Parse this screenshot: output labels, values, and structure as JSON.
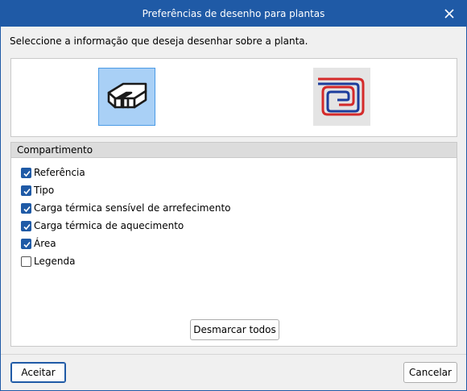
{
  "window": {
    "title": "Preferências de desenho para plantas"
  },
  "instruction": "Seleccione a informação que deseja desenhar sobre a planta.",
  "icons": [
    {
      "name": "compartment-icon",
      "selected": true
    },
    {
      "name": "floor-heating-icon",
      "selected": false
    }
  ],
  "section": {
    "header": "Compartimento",
    "items": [
      {
        "label": "Referência",
        "checked": true
      },
      {
        "label": "Tipo",
        "checked": true
      },
      {
        "label": "Carga térmica sensível de arrefecimento",
        "checked": true
      },
      {
        "label": "Carga térmica de aquecimento",
        "checked": true
      },
      {
        "label": "Área",
        "checked": true
      },
      {
        "label": "Legenda",
        "checked": false
      }
    ],
    "toggle_label": "Desmarcar todos"
  },
  "footer": {
    "accept_label": "Aceitar",
    "cancel_label": "Cancelar"
  },
  "colors": {
    "accent": "#1f5aa6",
    "selected_icon_bg": "#a9d0f6",
    "floor_heat_blue": "#1c3d9c",
    "floor_heat_red": "#d42a2a"
  }
}
